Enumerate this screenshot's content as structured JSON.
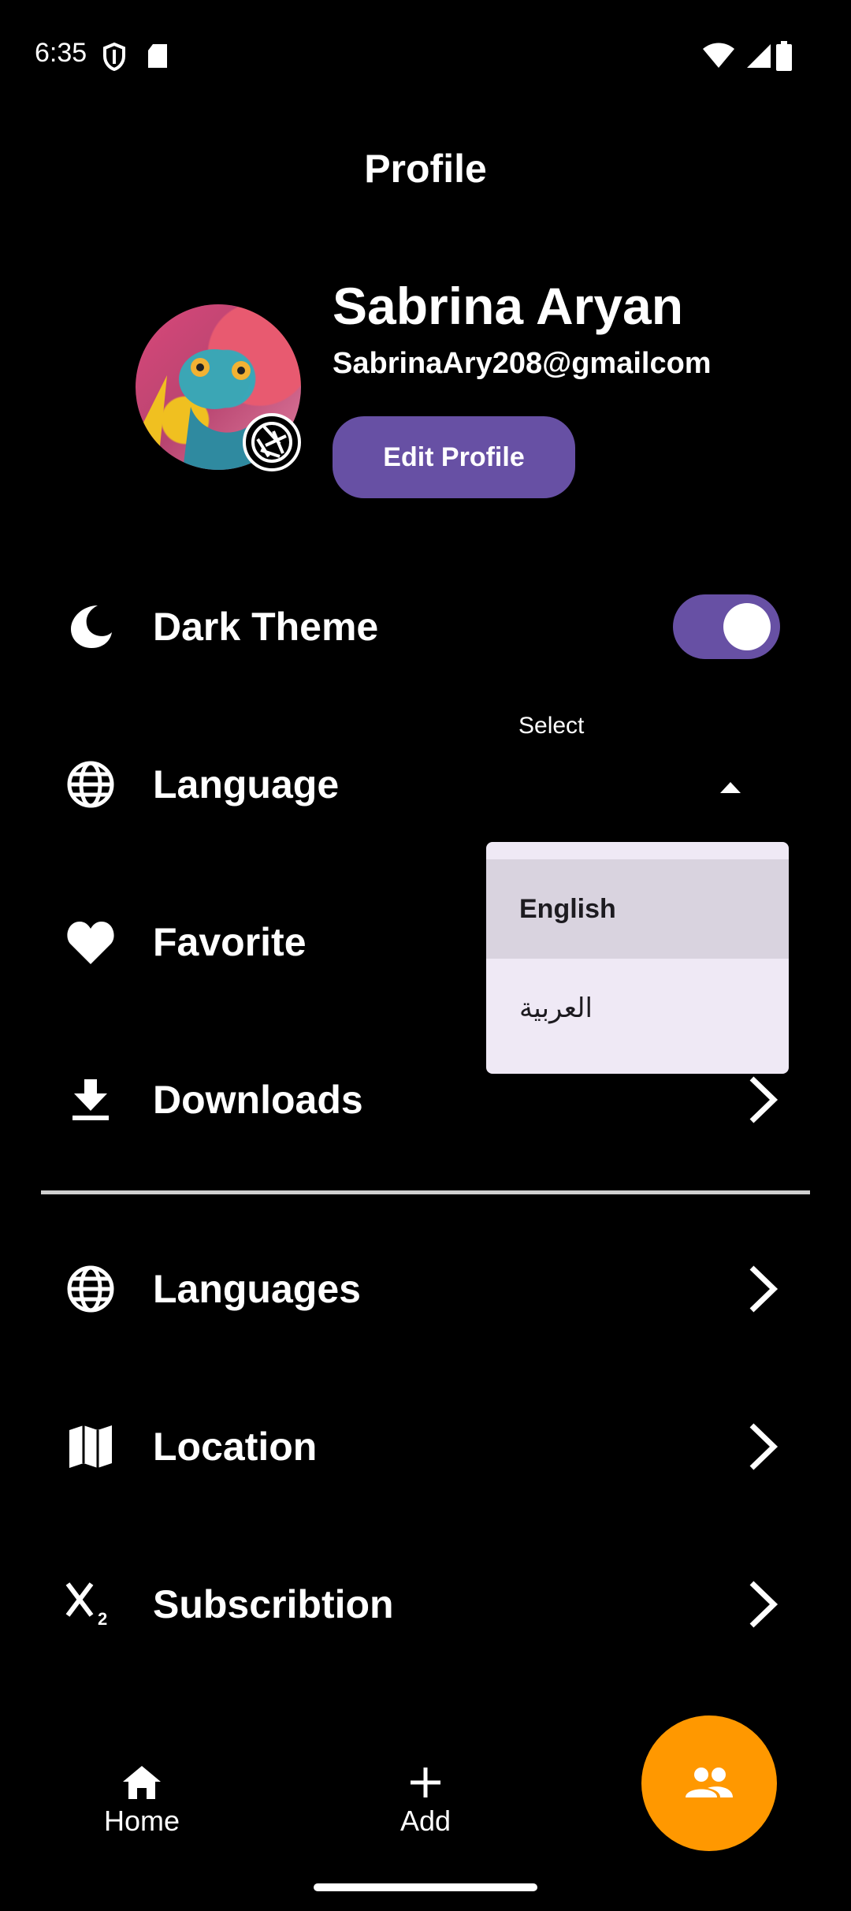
{
  "status_bar": {
    "time": "6:35"
  },
  "page": {
    "title": "Profile"
  },
  "profile": {
    "name": "Sabrina Aryan",
    "email": "SabrinaAry208@gmailcom",
    "edit_button": "Edit Profile"
  },
  "settings": {
    "dark_theme": {
      "label": "Dark Theme",
      "enabled": true
    },
    "language": {
      "label": "Language",
      "select_hint": "Select"
    },
    "favorite": {
      "label": "Favorite"
    },
    "downloads": {
      "label": "Downloads"
    },
    "languages": {
      "label": "Languages"
    },
    "location": {
      "label": "Location"
    },
    "subscription": {
      "label": "Subscribtion"
    }
  },
  "language_dropdown": {
    "options": [
      "English",
      "العربية"
    ],
    "selected": "English"
  },
  "bottom_nav": {
    "home": "Home",
    "add": "Add"
  },
  "colors": {
    "accent": "#6750a4",
    "fab": "#ff9800",
    "background": "#000000"
  }
}
